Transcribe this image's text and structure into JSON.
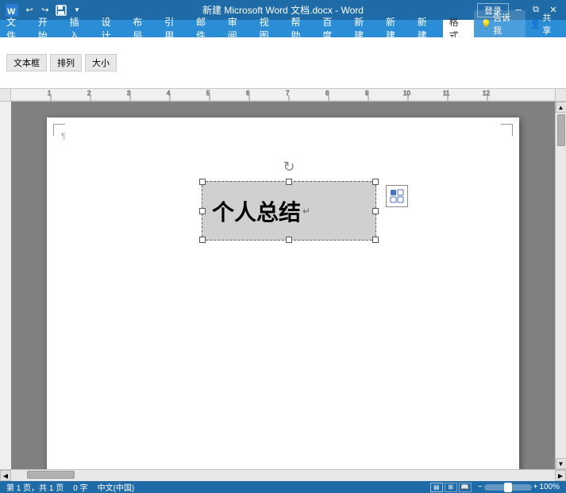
{
  "titlebar": {
    "title": "新建 Microsoft Word 文档.docx - Word",
    "login": "登录",
    "quickaccess": [
      "undo",
      "redo",
      "save",
      "dropdown"
    ]
  },
  "ribbon": {
    "tabs": [
      "文件",
      "开始",
      "插入",
      "设计",
      "布局",
      "引用",
      "邮件",
      "审阅",
      "视图",
      "帮助",
      "百度",
      "新建",
      "新建",
      "新建",
      "格式"
    ],
    "active_tab": "格式",
    "tell_me": "告诉我",
    "share": "共享"
  },
  "toolbar": {
    "buttons": [
      "undo",
      "redo",
      "save"
    ]
  },
  "document": {
    "textbox_content": "个人总结",
    "page_number": "第 1 页，共 1 页",
    "word_count": "0 字",
    "zoom": "100%"
  },
  "statusbar": {
    "page_info": "第 1 页，共 1 页",
    "word_count": "0 字",
    "language": "中文(中国)",
    "zoom_level": "100%"
  }
}
